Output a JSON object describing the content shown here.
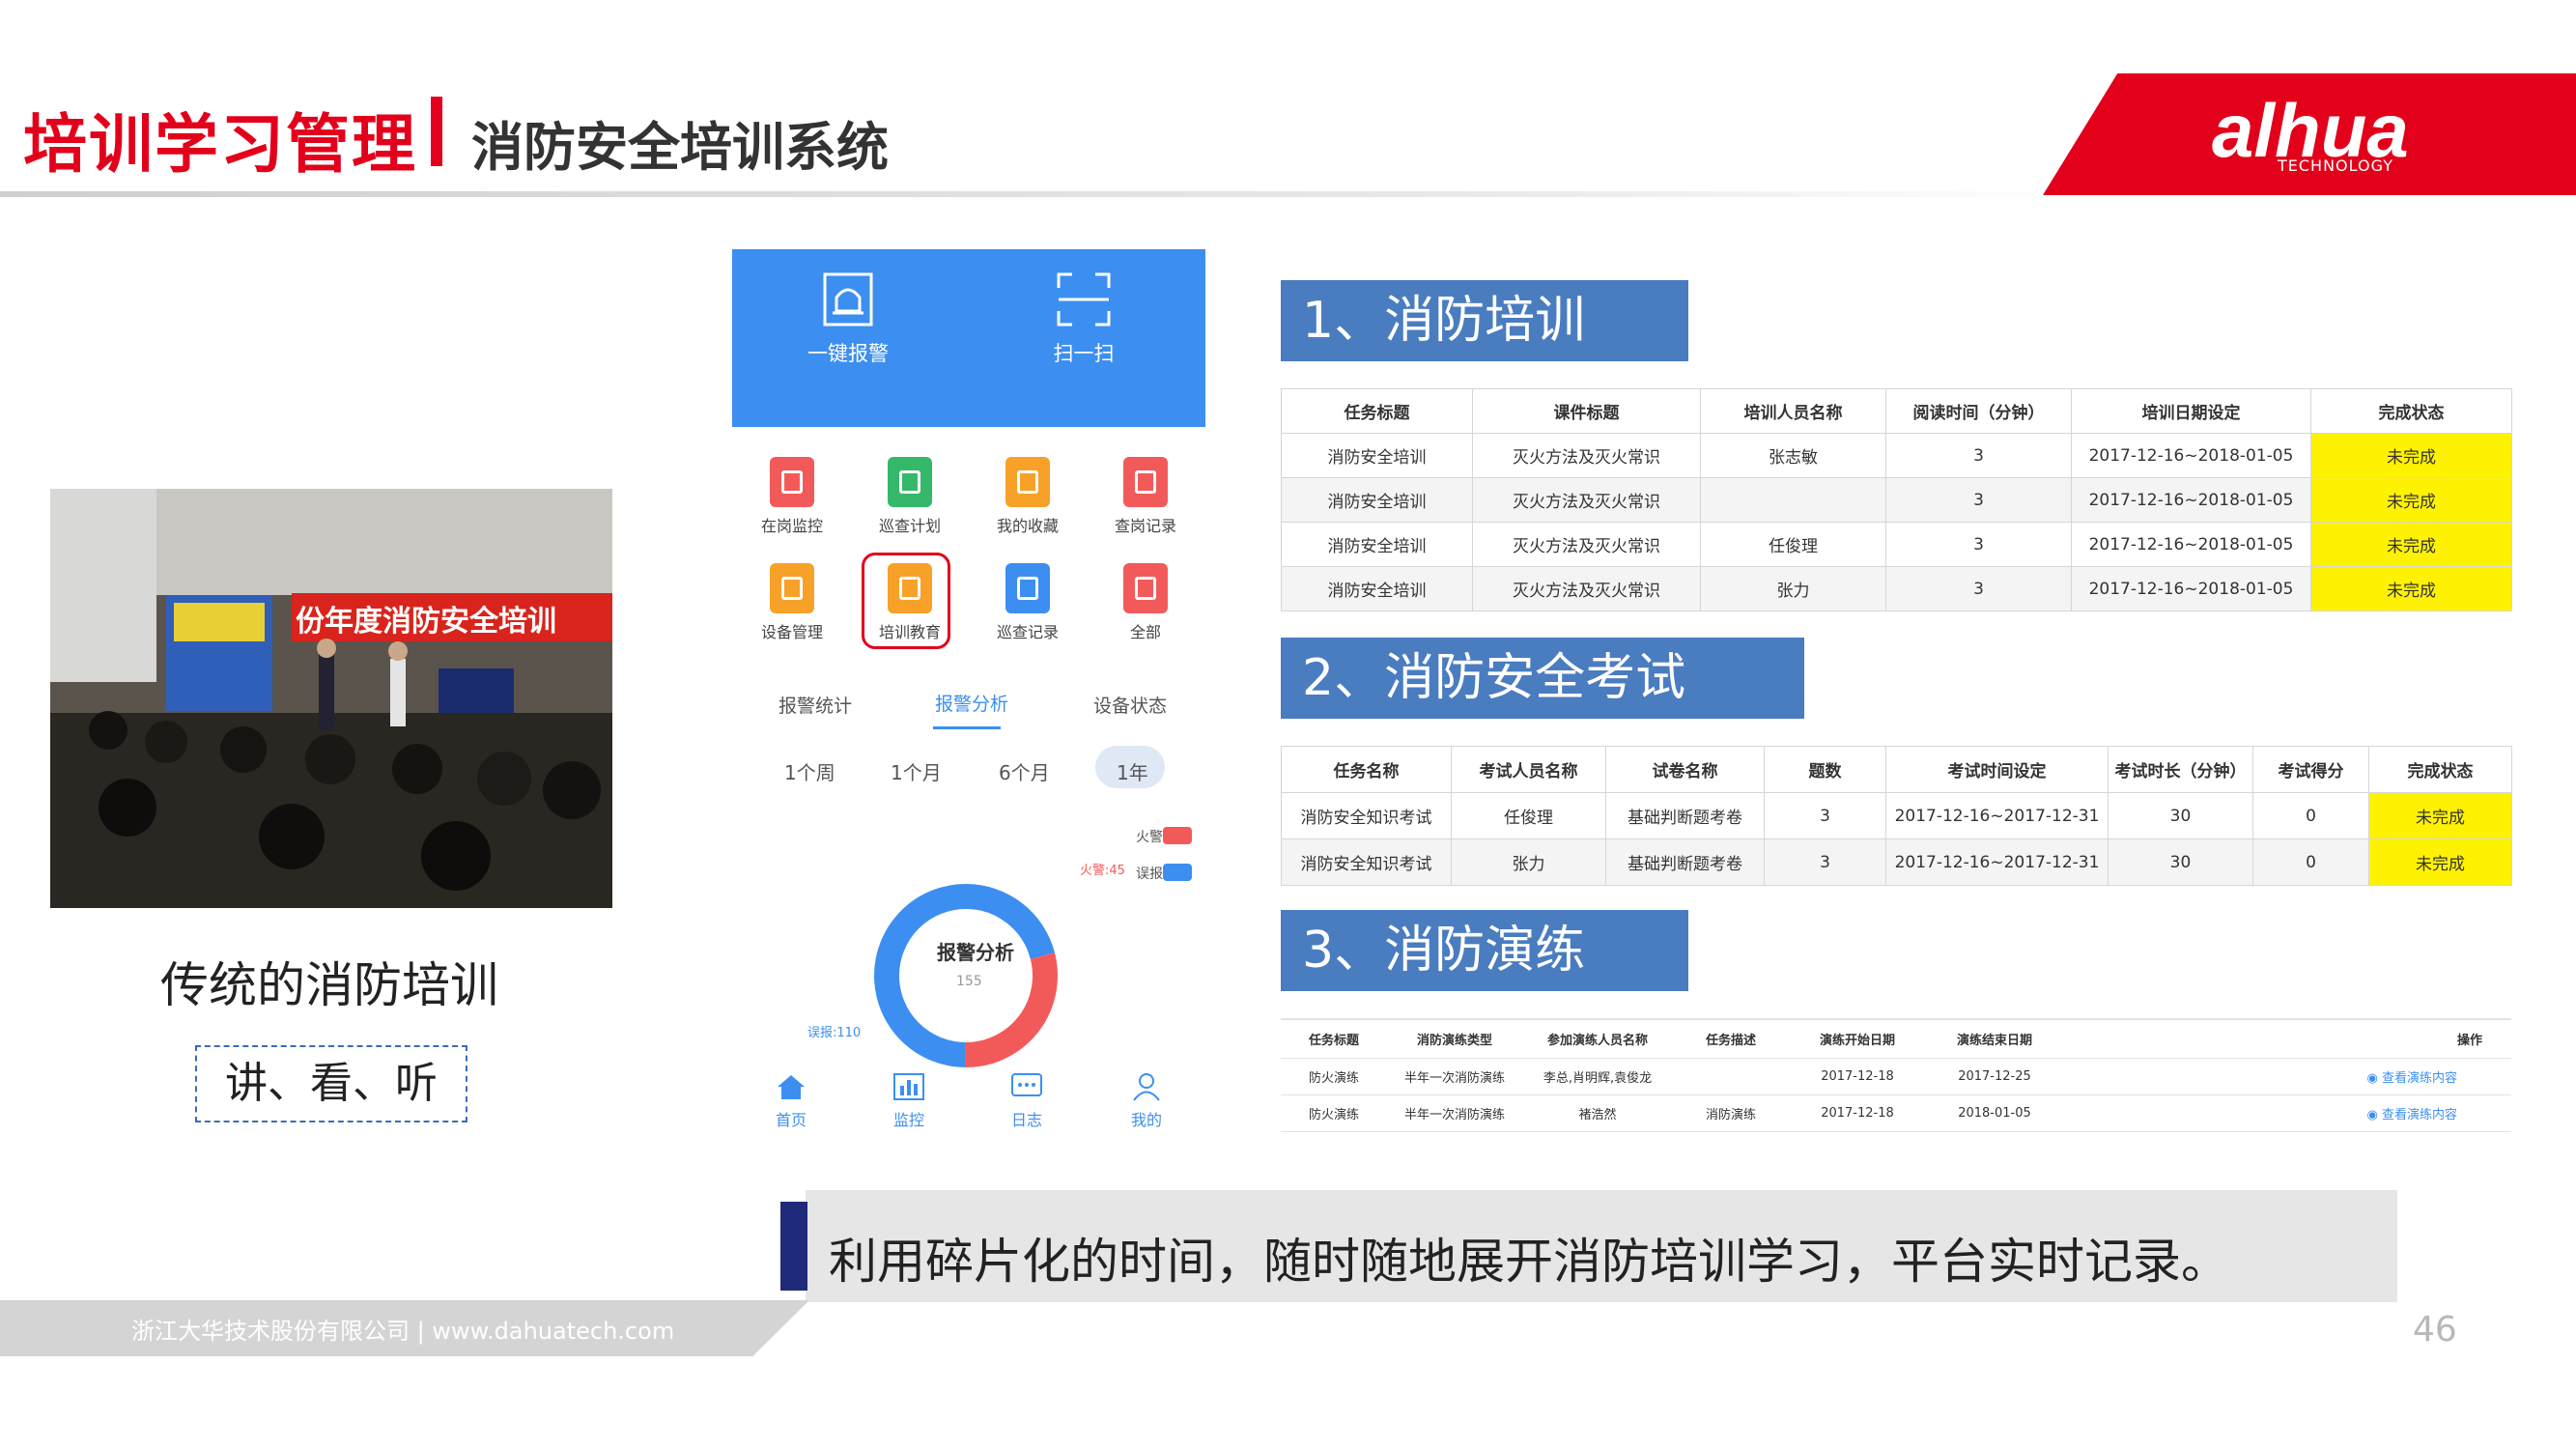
{
  "header": {
    "title": "培训学习管理",
    "subtitle": "消防安全培训系统"
  },
  "logo": {
    "brand": "alhua",
    "tagline": "TECHNOLOGY"
  },
  "left": {
    "photo_banner": "份年度消防安全培训",
    "caption": "传统的消防培训",
    "methods": "讲、看、听"
  },
  "phone": {
    "top_buttons": [
      {
        "label": "一键报警",
        "icon": "alarm-icon"
      },
      {
        "label": "扫一扫",
        "icon": "scan-icon"
      }
    ],
    "grid": [
      {
        "label": "在岗监控",
        "color": "#f25a5a"
      },
      {
        "label": "巡查计划",
        "color": "#36b86a"
      },
      {
        "label": "我的收藏",
        "color": "#f7a128"
      },
      {
        "label": "查岗记录",
        "color": "#f25a5a"
      },
      {
        "label": "设备管理",
        "color": "#f7a128"
      },
      {
        "label": "培训教育",
        "color": "#f7a128"
      },
      {
        "label": "巡查记录",
        "color": "#3c8ff0"
      },
      {
        "label": "全部",
        "color": "#f25a5a"
      }
    ],
    "tabs": [
      "报警统计",
      "报警分析",
      "设备状态"
    ],
    "periods": [
      "1个周",
      "1个月",
      "6个月",
      "1年"
    ],
    "legend": [
      "火警",
      "误报"
    ],
    "donut": {
      "title": "报警分析",
      "total": "155",
      "fire_label": "火警:45",
      "false_label": "误报:110",
      "fire": 45,
      "false_alarm": 110
    },
    "nav": [
      "首页",
      "监控",
      "日志",
      "我的"
    ],
    "colors": {
      "fire": "#f25a5a",
      "false_alarm": "#3c8ff0"
    }
  },
  "sections": [
    {
      "title": "1、消防培训",
      "columns": [
        "任务标题",
        "课件标题",
        "培训人员名称",
        "阅读时间（分钟）",
        "培训日期设定",
        "完成状态"
      ],
      "rows": [
        [
          "消防安全培训",
          "灭火方法及灭火常识",
          "张志敏",
          "3",
          "2017-12-16~2018-01-05",
          "未完成"
        ],
        [
          "消防安全培训",
          "灭火方法及灭火常识",
          "",
          "3",
          "2017-12-16~2018-01-05",
          "未完成"
        ],
        [
          "消防安全培训",
          "灭火方法及灭火常识",
          "任俊理",
          "3",
          "2017-12-16~2018-01-05",
          "未完成"
        ],
        [
          "消防安全培训",
          "灭火方法及灭火常识",
          "张力",
          "3",
          "2017-12-16~2018-01-05",
          "未完成"
        ]
      ]
    },
    {
      "title": "2、消防安全考试",
      "columns": [
        "任务名称",
        "考试人员名称",
        "试卷名称",
        "题数",
        "考试时间设定",
        "考试时长（分钟）",
        "考试得分",
        "完成状态"
      ],
      "rows": [
        [
          "消防安全知识考试",
          "任俊理",
          "基础判断题考卷",
          "3",
          "2017-12-16~2017-12-31",
          "30",
          "0",
          "未完成"
        ],
        [
          "消防安全知识考试",
          "张力",
          "基础判断题考卷",
          "3",
          "2017-12-16~2017-12-31",
          "30",
          "0",
          "未完成"
        ]
      ]
    },
    {
      "title": "3、消防演练",
      "columns": [
        "任务标题",
        "消防演练类型",
        "参加演练人员名称",
        "任务描述",
        "演练开始日期",
        "演练结束日期",
        "操作"
      ],
      "rows": [
        [
          "防火演练",
          "半年一次消防演练",
          "李总,肖明辉,袁俊龙",
          "",
          "2017-12-18",
          "2017-12-25",
          "查看演练内容"
        ],
        [
          "防火演练",
          "半年一次消防演练",
          "褚浩然",
          "消防演练",
          "2017-12-18",
          "2018-01-05",
          "查看演练内容"
        ]
      ]
    }
  ],
  "banner": "利用碎片化的时间，随时随地展开消防培训学习，平台实时记录。",
  "footer": "浙江大华技术股份有限公司 | www.dahuatech.com",
  "page_number": "46"
}
